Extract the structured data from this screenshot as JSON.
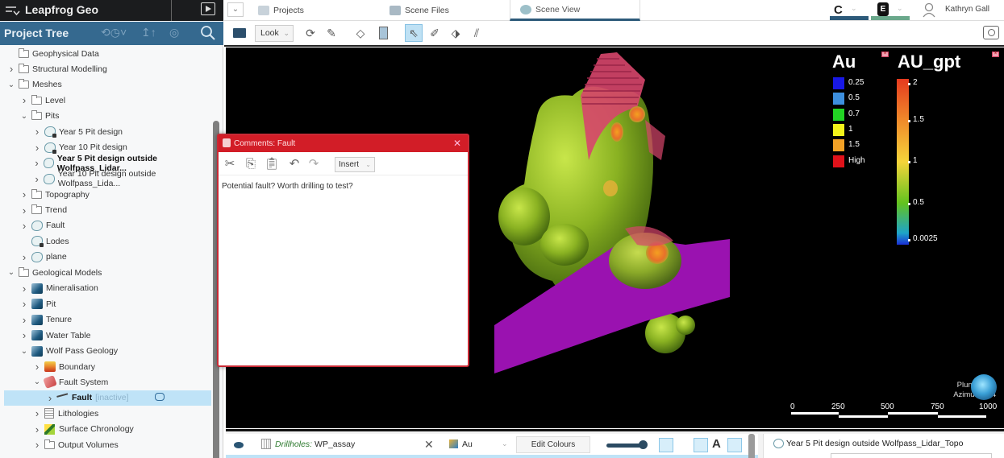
{
  "app": {
    "name": "Leapfrog Geo",
    "icons": {
      "menu": "menu-chevron-icon",
      "play": "play-icon"
    }
  },
  "project_tree": {
    "title": "Project Tree",
    "header_icons": [
      "history-icon",
      "upload-icon",
      "pause-icon",
      "search-icon"
    ],
    "items": [
      {
        "label": "Geophysical Data",
        "depth": 1,
        "expand": "none",
        "icon": "folder-icon"
      },
      {
        "label": "Structural Modelling",
        "depth": 1,
        "expand": "collapsed",
        "icon": "folder-icon"
      },
      {
        "label": "Meshes",
        "depth": 1,
        "expand": "expanded",
        "icon": "folder-icon"
      },
      {
        "label": "Level",
        "depth": 2,
        "expand": "collapsed",
        "icon": "folder-icon"
      },
      {
        "label": "Pits",
        "depth": 2,
        "expand": "expanded",
        "icon": "folder-icon"
      },
      {
        "label": "Year 5 Pit design",
        "depth": 3,
        "expand": "collapsed",
        "icon": "mesh-locked-icon"
      },
      {
        "label": "Year 10 Pit design",
        "depth": 3,
        "expand": "collapsed",
        "icon": "mesh-locked-icon"
      },
      {
        "label": "Year 5 Pit design outside Wolfpass_Lidar...",
        "depth": 3,
        "expand": "collapsed",
        "icon": "mesh-icon",
        "bold": true
      },
      {
        "label": "Year 10 Pit design outside Wolfpass_Lida...",
        "depth": 3,
        "expand": "collapsed",
        "icon": "mesh-icon"
      },
      {
        "label": "Topography",
        "depth": 2,
        "expand": "collapsed",
        "icon": "folder-icon"
      },
      {
        "label": "Trend",
        "depth": 2,
        "expand": "collapsed",
        "icon": "folder-icon"
      },
      {
        "label": "Fault",
        "depth": 2,
        "expand": "collapsed",
        "icon": "mesh-icon"
      },
      {
        "label": "Lodes",
        "depth": 2,
        "expand": "none",
        "icon": "mesh-locked-icon"
      },
      {
        "label": "plane",
        "depth": 2,
        "expand": "collapsed",
        "icon": "mesh-icon"
      },
      {
        "label": "Geological Models",
        "depth": 1,
        "expand": "expanded",
        "icon": "folder-icon"
      },
      {
        "label": "Mineralisation",
        "depth": 2,
        "expand": "collapsed",
        "icon": "geomodel-icon"
      },
      {
        "label": "Pit",
        "depth": 2,
        "expand": "collapsed",
        "icon": "geomodel-icon"
      },
      {
        "label": "Tenure",
        "depth": 2,
        "expand": "collapsed",
        "icon": "geomodel-icon"
      },
      {
        "label": "Water Table",
        "depth": 2,
        "expand": "collapsed",
        "icon": "geomodel-icon"
      },
      {
        "label": "Wolf Pass Geology",
        "depth": 2,
        "expand": "expanded",
        "icon": "geomodel-icon"
      },
      {
        "label": "Boundary",
        "depth": 3,
        "expand": "collapsed",
        "icon": "boundary-icon"
      },
      {
        "label": "Fault System",
        "depth": 3,
        "expand": "expanded",
        "icon": "fault-system-icon"
      },
      {
        "label": "Fault",
        "depth": 4,
        "expand": "collapsed",
        "icon": "fault-icon",
        "bold": true,
        "selected": true,
        "status": "[inactive]",
        "has_comment": true
      },
      {
        "label": "Lithologies",
        "depth": 3,
        "expand": "collapsed",
        "icon": "lithologies-icon"
      },
      {
        "label": "Surface Chronology",
        "depth": 3,
        "expand": "collapsed",
        "icon": "chronology-icon"
      },
      {
        "label": "Output Volumes",
        "depth": 3,
        "expand": "collapsed",
        "icon": "folder-icon"
      }
    ]
  },
  "tabs": [
    {
      "label": "Projects",
      "icon": "projects-icon"
    },
    {
      "label": "Scene Files",
      "icon": "scene-files-icon"
    },
    {
      "label": "Scene View",
      "icon": "scene-view-icon",
      "active": true
    }
  ],
  "account": {
    "user": "Kathryn Gall",
    "services": [
      {
        "icon": "central-icon",
        "color": "#2d5a7a"
      },
      {
        "icon": "evo-icon",
        "color": "#6aa88b"
      }
    ]
  },
  "toolbar": {
    "look_label": "Look",
    "tools": [
      "scene-settings-icon",
      "rotate-icon",
      "slice-icon",
      "draw-plane-icon",
      "section-icon",
      "select-icon",
      "draw-line-icon",
      "measure-plane-icon",
      "ruler-icon"
    ],
    "active_tool": "select-icon",
    "camera_icon": "camera-icon"
  },
  "legends": {
    "au": {
      "title": "Au",
      "entries": [
        {
          "label": "0.25",
          "color": "#1818e6"
        },
        {
          "label": "0.5",
          "color": "#3d8fde"
        },
        {
          "label": "0.7",
          "color": "#22d424"
        },
        {
          "label": "1",
          "color": "#f2f21a"
        },
        {
          "label": "1.5",
          "color": "#f2a126"
        },
        {
          "label": "High",
          "color": "#e0121a"
        }
      ]
    },
    "au_gpt": {
      "title": "AU_gpt",
      "ticks": [
        "2",
        "1.5",
        "1",
        "0.5",
        "0.0025"
      ]
    }
  },
  "scene": {
    "plunge": "Plunge +50",
    "azimuth": "Azimuth 354",
    "scale_labels": [
      "0",
      "250",
      "500",
      "750",
      "1000"
    ]
  },
  "comments_dialog": {
    "title": "Comments: Fault",
    "tools": [
      "cut-icon",
      "copy-icon",
      "paste-icon",
      "undo-icon",
      "redo-icon"
    ],
    "insert_label": "Insert",
    "text": "Potential fault? Worth drilling to test?"
  },
  "shown_items": {
    "row": {
      "type_label": "Drillholes:",
      "name": "WP_assay",
      "column": "Au",
      "edit_colours_label": "Edit Colours"
    },
    "properties_title": "Year 5 Pit design outside Wolfpass_Lidar_Topo"
  }
}
